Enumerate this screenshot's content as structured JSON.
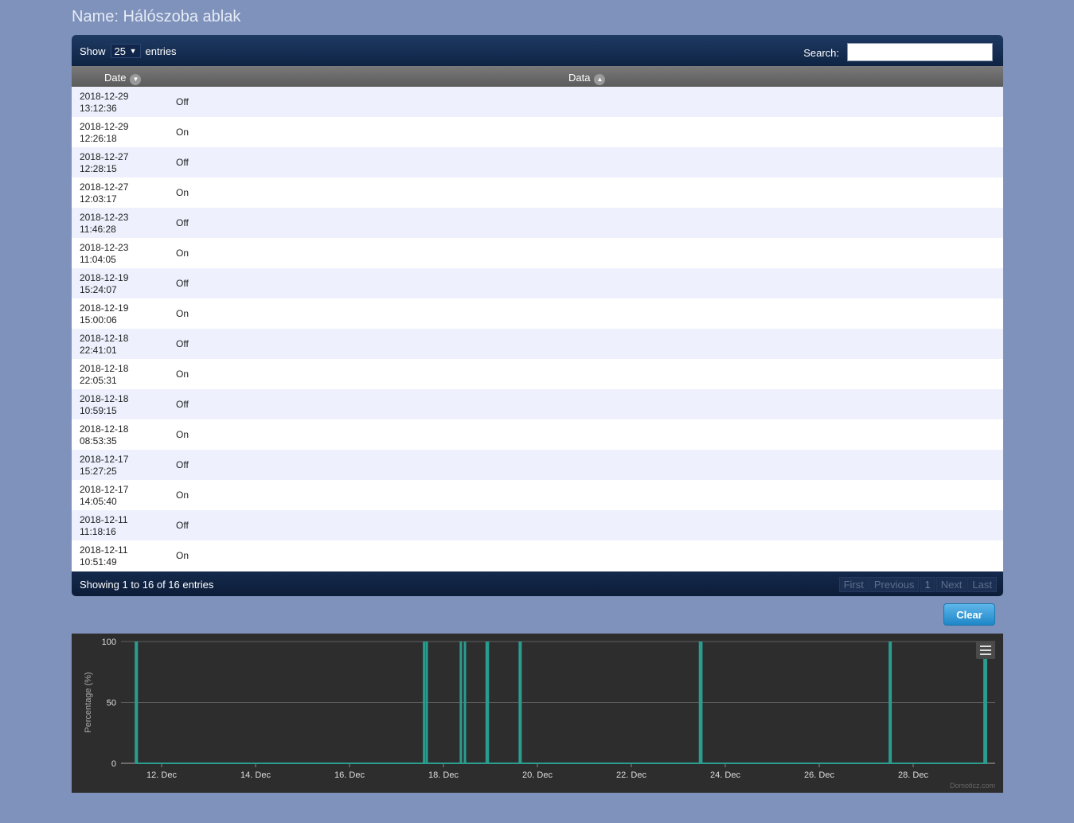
{
  "page": {
    "title": "Name: Hálószoba ablak"
  },
  "table": {
    "show_label": "Show",
    "page_length": "25",
    "entries_label": "entries",
    "search_label": "Search:",
    "search_value": "",
    "columns": [
      "Date",
      "Data"
    ],
    "rows": [
      {
        "date": "2018-12-29",
        "time": "13:12:36",
        "data": "Off"
      },
      {
        "date": "2018-12-29",
        "time": "12:26:18",
        "data": "On"
      },
      {
        "date": "2018-12-27",
        "time": "12:28:15",
        "data": "Off"
      },
      {
        "date": "2018-12-27",
        "time": "12:03:17",
        "data": "On"
      },
      {
        "date": "2018-12-23",
        "time": "11:46:28",
        "data": "Off"
      },
      {
        "date": "2018-12-23",
        "time": "11:04:05",
        "data": "On"
      },
      {
        "date": "2018-12-19",
        "time": "15:24:07",
        "data": "Off"
      },
      {
        "date": "2018-12-19",
        "time": "15:00:06",
        "data": "On"
      },
      {
        "date": "2018-12-18",
        "time": "22:41:01",
        "data": "Off"
      },
      {
        "date": "2018-12-18",
        "time": "22:05:31",
        "data": "On"
      },
      {
        "date": "2018-12-18",
        "time": "10:59:15",
        "data": "Off"
      },
      {
        "date": "2018-12-18",
        "time": "08:53:35",
        "data": "On"
      },
      {
        "date": "2018-12-17",
        "time": "15:27:25",
        "data": "Off"
      },
      {
        "date": "2018-12-17",
        "time": "14:05:40",
        "data": "On"
      },
      {
        "date": "2018-12-11",
        "time": "11:18:16",
        "data": "Off"
      },
      {
        "date": "2018-12-11",
        "time": "10:51:49",
        "data": "On"
      }
    ],
    "info": "Showing 1 to 16 of 16 entries",
    "pager": {
      "first": "First",
      "previous": "Previous",
      "current": "1",
      "next": "Next",
      "last": "Last"
    }
  },
  "clear_label": "Clear",
  "chart_data": {
    "type": "area",
    "ylabel": "Percentage (%)",
    "ylim": [
      0,
      100
    ],
    "yticks": [
      0,
      50,
      100
    ],
    "xticks": [
      "12. Dec",
      "14. Dec",
      "16. Dec",
      "18. Dec",
      "20. Dec",
      "22. Dec",
      "24. Dec",
      "26. Dec",
      "28. Dec"
    ],
    "credit": "Domoticz.com",
    "series": [
      {
        "color": "#2a9d8f",
        "on_intervals": [
          [
            "2018-12-11 10:51:49",
            "2018-12-11 11:18:16"
          ],
          [
            "2018-12-17 14:05:40",
            "2018-12-17 15:27:25"
          ],
          [
            "2018-12-18 08:53:35",
            "2018-12-18 10:59:15"
          ],
          [
            "2018-12-18 22:05:31",
            "2018-12-18 22:41:01"
          ],
          [
            "2018-12-19 15:00:06",
            "2018-12-19 15:24:07"
          ],
          [
            "2018-12-23 11:04:05",
            "2018-12-23 11:46:28"
          ],
          [
            "2018-12-27 12:03:17",
            "2018-12-27 12:28:15"
          ],
          [
            "2018-12-29 12:26:18",
            "2018-12-29 13:12:36"
          ]
        ]
      }
    ]
  }
}
